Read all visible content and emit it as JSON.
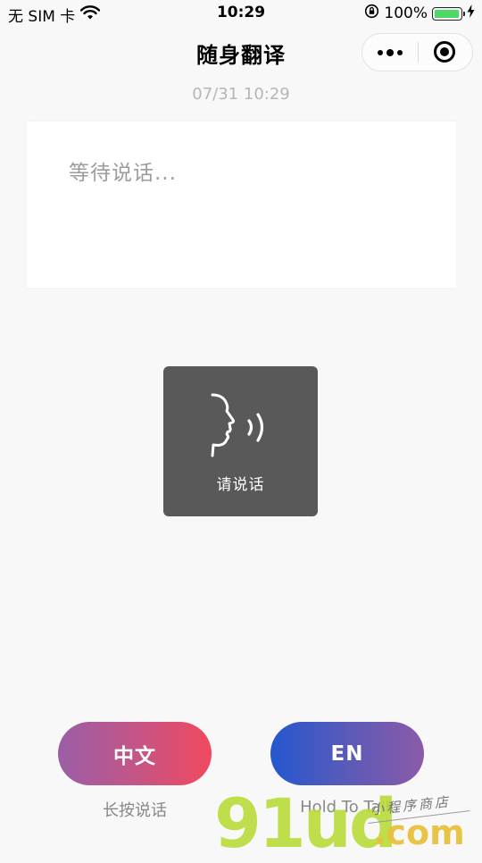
{
  "status_bar": {
    "carrier": "无 SIM 卡",
    "time": "10:29",
    "battery_percent": "100%",
    "battery_level": 1.0
  },
  "nav": {
    "title": "随身翻译"
  },
  "timestamp": "07/31 10:29",
  "text_card": {
    "placeholder": "等待说话..."
  },
  "voice_toast": {
    "label": "请说话"
  },
  "buttons": {
    "chinese": {
      "label": "中文",
      "hint": "长按说话"
    },
    "english": {
      "label": "EN",
      "hint": "Hold To Talk"
    }
  },
  "watermark": {
    "brand": "91ud",
    "domain": ".com",
    "subtitle": "小程序商店"
  },
  "colors": {
    "battery": "#4cd964",
    "toast_bg": "#595959",
    "cn_gradient": [
      "#9a5ea6",
      "#f0495e"
    ],
    "en_gradient": [
      "#2457cf",
      "#8c5aa8"
    ]
  }
}
